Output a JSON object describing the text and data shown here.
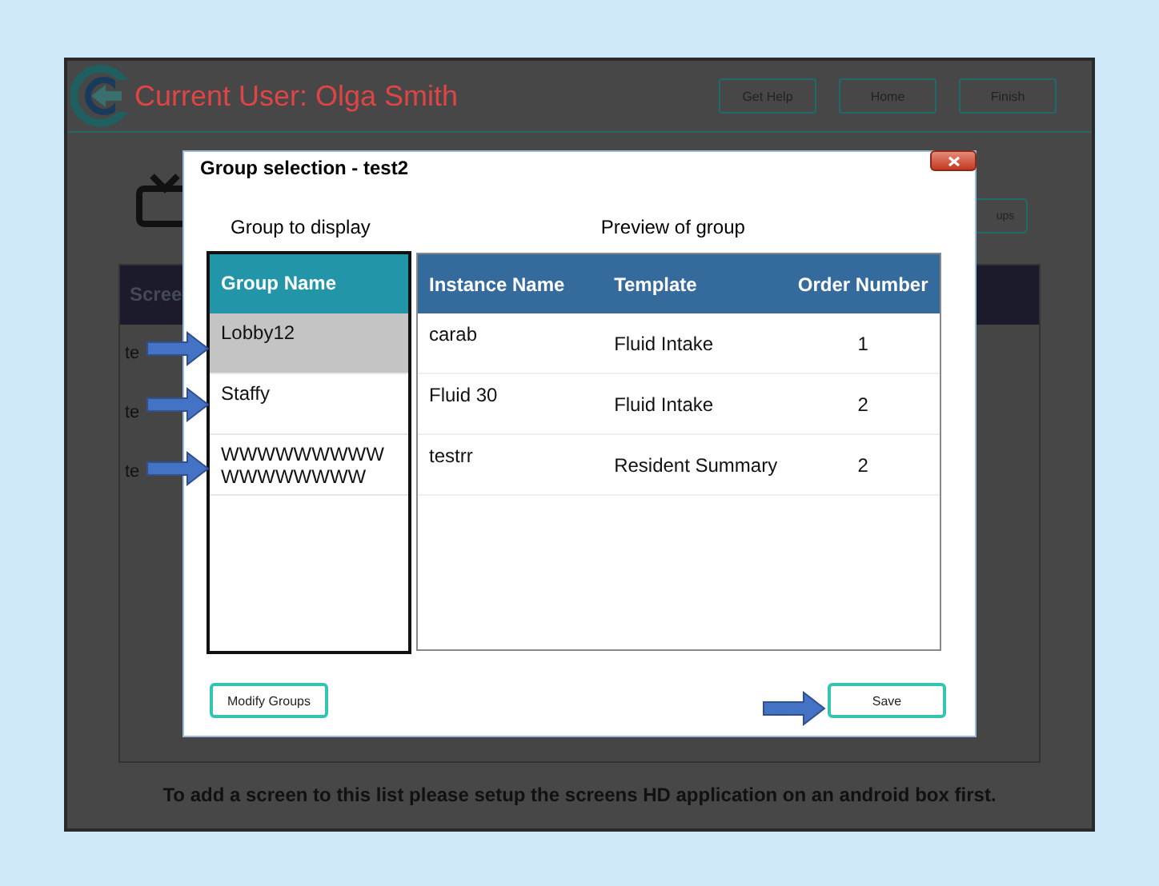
{
  "app": {
    "title": "Current User: Olga Smith",
    "buttons": [
      "Get Help",
      "Home",
      "Finish"
    ],
    "partial_button": "ups",
    "table": {
      "column_1": "Scree",
      "rows": [
        "te",
        "te",
        "te"
      ]
    },
    "footer": "To add a screen to this list please setup the screens HD application on an android box first."
  },
  "dialog": {
    "title": "Group selection - test2",
    "group_heading": "Group to display",
    "preview_heading": "Preview of group",
    "groups": {
      "column": "Group Name",
      "items": [
        {
          "name": "Lobby12",
          "selected": true
        },
        {
          "name": "Staffy",
          "selected": false
        },
        {
          "name": "WWWWWWWWWWWWWWWWW",
          "selected": false
        }
      ]
    },
    "preview": {
      "columns": [
        "Instance Name",
        "Template",
        "Order Number"
      ],
      "rows": [
        [
          "carab",
          "Fluid Intake",
          "1"
        ],
        [
          "Fluid 30",
          "Fluid Intake",
          "2"
        ],
        [
          "testrr",
          "Resident Summary",
          "2"
        ]
      ]
    },
    "buttons": {
      "modify": "Modify Groups",
      "save": "Save"
    }
  }
}
